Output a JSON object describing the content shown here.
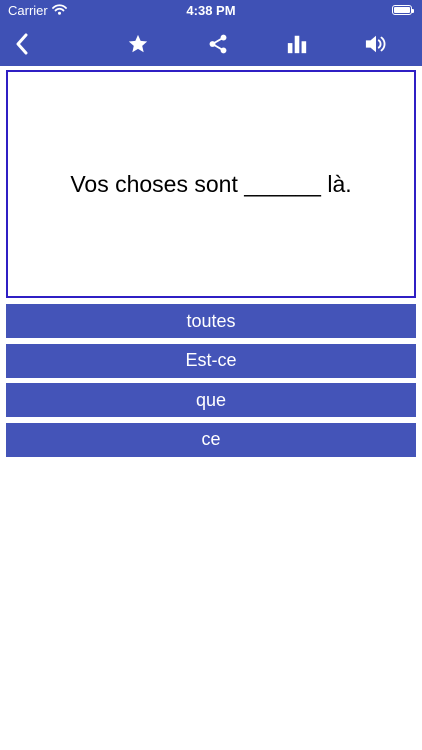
{
  "status_bar": {
    "carrier": "Carrier",
    "time": "4:38 PM",
    "battery_level": 1.0
  },
  "toolbar": {
    "icons": [
      "back-chevron-icon",
      "star-icon",
      "share-icon",
      "bar-chart-icon",
      "speaker-icon"
    ]
  },
  "quiz": {
    "question": "Vos choses sont ______ là.",
    "answers": [
      "toutes",
      "Est-ce",
      "que",
      "ce"
    ]
  },
  "colors": {
    "bar": "#3f51b5",
    "answer_button": "#4454b8",
    "card_border": "#2f1fc4"
  }
}
